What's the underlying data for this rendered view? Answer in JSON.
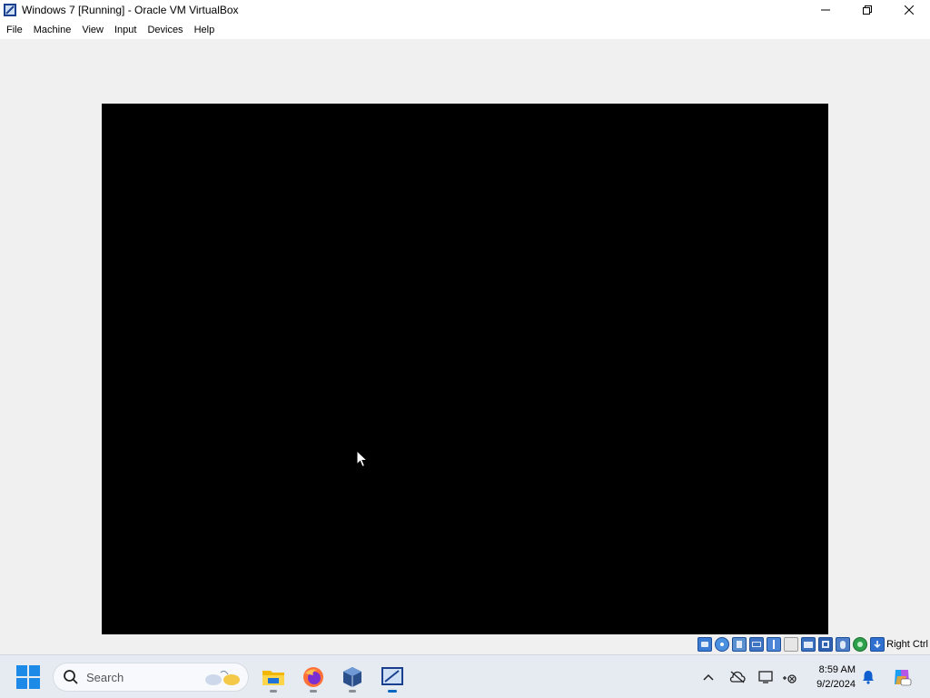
{
  "window": {
    "title": "Windows 7 [Running] - Oracle VM VirtualBox"
  },
  "menu": [
    "File",
    "Machine",
    "View",
    "Input",
    "Devices",
    "Help"
  ],
  "status": {
    "host_key": "Right Ctrl",
    "icons": [
      "hard-disk-icon",
      "optical-drive-icon",
      "audio-icon",
      "network-icon",
      "usb-icon",
      "shared-folders-icon",
      "display-icon",
      "recording-icon",
      "mouse-integration-icon",
      "cpu-icon",
      "keyboard-icon"
    ]
  },
  "taskbar": {
    "search_placeholder": "Search",
    "apps": [
      "file-explorer",
      "firefox",
      "virtualbox-manager",
      "virtualbox-vm"
    ],
    "clock": {
      "time": "8:59 AM",
      "date": "9/2/2024"
    }
  },
  "colors": {
    "vm_background": "#000000",
    "accent": "#0067c0"
  }
}
